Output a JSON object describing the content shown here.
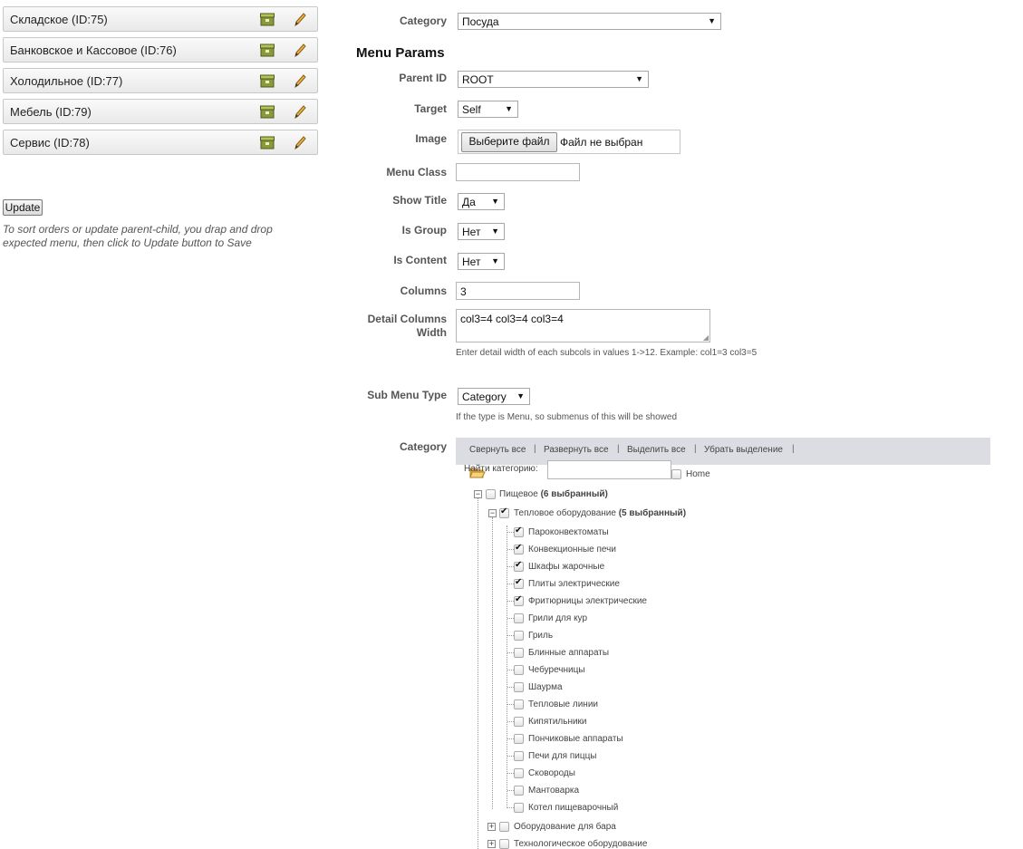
{
  "left_menu": {
    "items": [
      {
        "label": "Складское (ID:75)"
      },
      {
        "label": "Банковское и Кассовое (ID:76)"
      },
      {
        "label": "Холодильное (ID:77)"
      },
      {
        "label": "Мебель (ID:79)"
      },
      {
        "label": "Сервис (ID:78)"
      }
    ],
    "update_label": "Update",
    "hint": "To sort orders or update parent-child, you drap and drop expected menu, then click to Update button to Save"
  },
  "form": {
    "category_label": "Category",
    "category_value": "Посуда",
    "section_title": "Menu Params",
    "parent_id_label": "Parent ID",
    "parent_id_value": "ROOT",
    "target_label": "Target",
    "target_value": "Self",
    "image_label": "Image",
    "file_button": "Выберите файл",
    "file_status": "Файл не выбран",
    "menu_class_label": "Menu Class",
    "menu_class_value": "",
    "show_title_label": "Show Title",
    "show_title_value": "Да",
    "is_group_label": "Is Group",
    "is_group_value": "Нет",
    "is_content_label": "Is Content",
    "is_content_value": "Нет",
    "columns_label": "Columns",
    "columns_value": "3",
    "detail_label_1": "Detail Columns",
    "detail_label_2": "Width",
    "detail_value": "col3=4 col3=4 col3=4",
    "detail_hint": "Enter detail width of each subcols in values 1->12. Example: col1=3 col3=5",
    "submenu_label": "Sub Menu Type",
    "submenu_value": "Category",
    "submenu_hint": "If the type is Menu, so submenus of this will be showed",
    "tree_label": "Category"
  },
  "tree": {
    "toolbar": [
      "Свернуть все",
      "Развернуть все",
      "Выделить все",
      "Убрать выделение"
    ],
    "search_label": "Найти категорию:",
    "search_value": "",
    "home_label": "Home",
    "root": {
      "label": "Пищевое",
      "count": "(6 выбранный)"
    },
    "group": {
      "label": "Тепловое оборудование",
      "count": "(5 выбранный)"
    },
    "children": [
      {
        "label": "Пароконвектоматы",
        "checked": true
      },
      {
        "label": "Конвекционные печи",
        "checked": true
      },
      {
        "label": "Шкафы жарочные",
        "checked": true
      },
      {
        "label": "Плиты электрические",
        "checked": true
      },
      {
        "label": "Фритюрницы электрические",
        "checked": true
      },
      {
        "label": "Грили для кур",
        "checked": false
      },
      {
        "label": "Гриль",
        "checked": false
      },
      {
        "label": "Блинные аппараты",
        "checked": false
      },
      {
        "label": "Чебуречницы",
        "checked": false
      },
      {
        "label": "Шаурма",
        "checked": false
      },
      {
        "label": "Тепловые линии",
        "checked": false
      },
      {
        "label": "Кипятильники",
        "checked": false
      },
      {
        "label": "Пончиковые аппараты",
        "checked": false
      },
      {
        "label": "Печи для пиццы",
        "checked": false
      },
      {
        "label": "Сковороды",
        "checked": false
      },
      {
        "label": "Мантоварка",
        "checked": false
      },
      {
        "label": "Котел пищеварочный",
        "checked": false
      }
    ],
    "siblings": [
      {
        "label": "Оборудование для бара"
      },
      {
        "label": "Технологическое оборудование"
      }
    ]
  }
}
